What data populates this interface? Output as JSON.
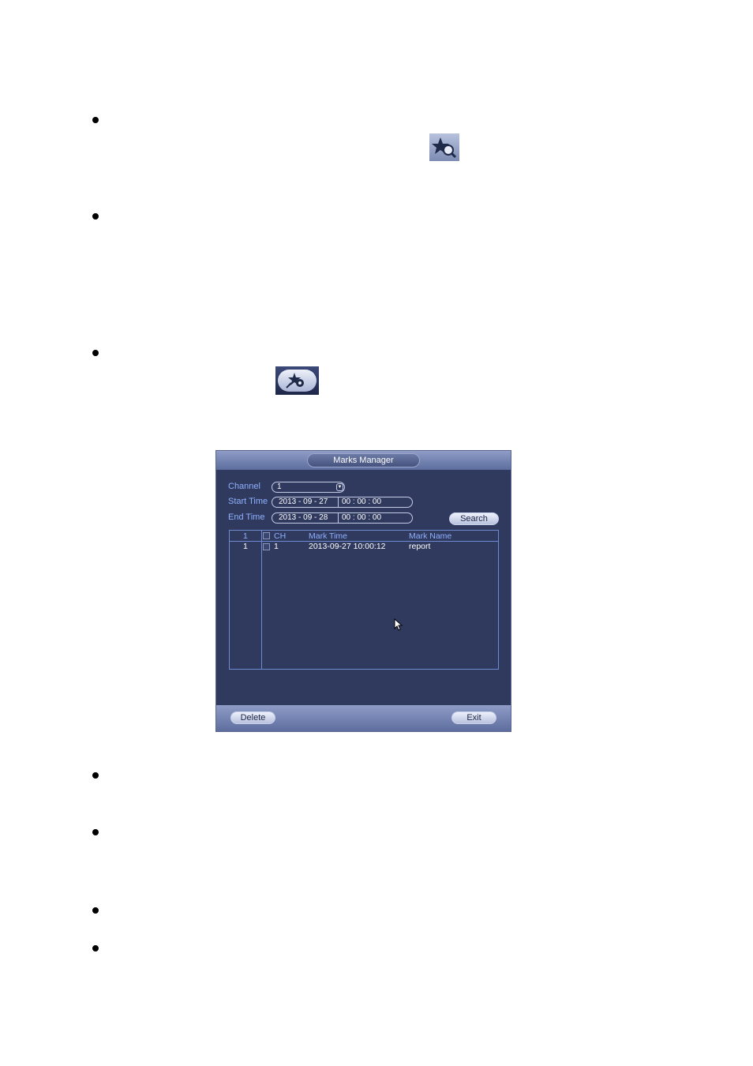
{
  "dialog": {
    "title": "Marks Manager",
    "channel_label": "Channel",
    "channel_value": "1",
    "start_label": "Start Time",
    "start_date": "2013 - 09 - 27",
    "start_time": "00 : 00 : 00",
    "end_label": "End Time",
    "end_date": "2013 - 09 - 28",
    "end_time": "00 : 00 : 00",
    "search_label": "Search",
    "table": {
      "headers": [
        "1",
        "CH",
        "Mark Time",
        "Mark Name"
      ],
      "rows": [
        {
          "index": "1",
          "ch": "1",
          "time": "2013-09-27 10:00:12",
          "name": "report"
        }
      ]
    },
    "delete_label": "Delete",
    "exit_label": "Exit"
  },
  "icons": {
    "mark_search": "mark-search-icon",
    "mark_manager": "mark-manager-icon"
  },
  "colors": {
    "dialog_bg": "#2f3a5e",
    "label_blue": "#8fb0ff"
  }
}
